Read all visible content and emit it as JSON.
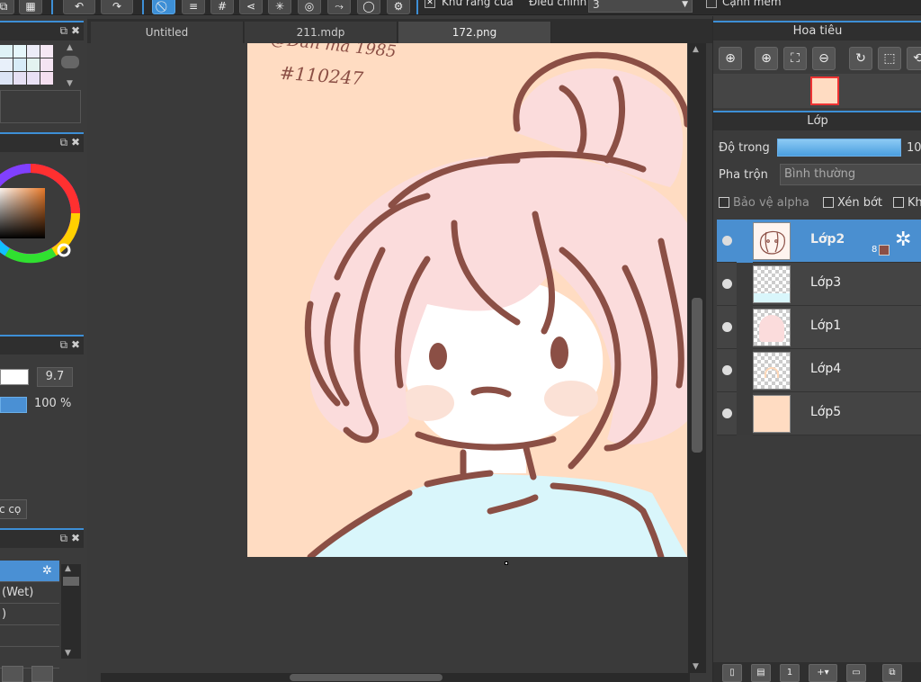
{
  "toolbar": {
    "antialias_label": "Khử răng cưa",
    "adjust_label": "Điều chỉnh",
    "adjust_value": "3",
    "soft_edge_label": "Cạnh mềm"
  },
  "left": {
    "brush_size_value": "9.7",
    "brush_opacity_value": "100 %",
    "brush_button_label": "c cọ",
    "brush_items": [
      "",
      "(Wet)",
      ")"
    ]
  },
  "tabs": [
    {
      "label": "Untitled"
    },
    {
      "label": "211.mdp"
    },
    {
      "label": "172.png"
    }
  ],
  "canvas": {
    "signature_line1": "@Đàn ma 1985",
    "signature_line2": "#110247"
  },
  "navigator": {
    "title": "Hoa tiêu"
  },
  "layers_panel": {
    "title": "Lớp",
    "opacity_label": "Độ trong",
    "opacity_value": "10",
    "blend_label": "Pha trộn",
    "blend_value": "Bình thường",
    "protect_alpha_label": "Bảo vệ alpha",
    "clip_label": "Xén bớt",
    "lock_label": "Kh",
    "layers": [
      {
        "name": "Lớp2",
        "selected": true,
        "badge": "8"
      },
      {
        "name": "Lớp3",
        "selected": false
      },
      {
        "name": "Lớp1",
        "selected": false
      },
      {
        "name": "Lớp4",
        "selected": false
      },
      {
        "name": "Lớp5",
        "selected": false
      }
    ]
  },
  "colors": {
    "accent": "#3d8fd6",
    "canvas_bg": "#ffdcc2",
    "hair": "#fbdcdc",
    "outline": "#8b4f45",
    "shirt": "#d9f6fb"
  }
}
